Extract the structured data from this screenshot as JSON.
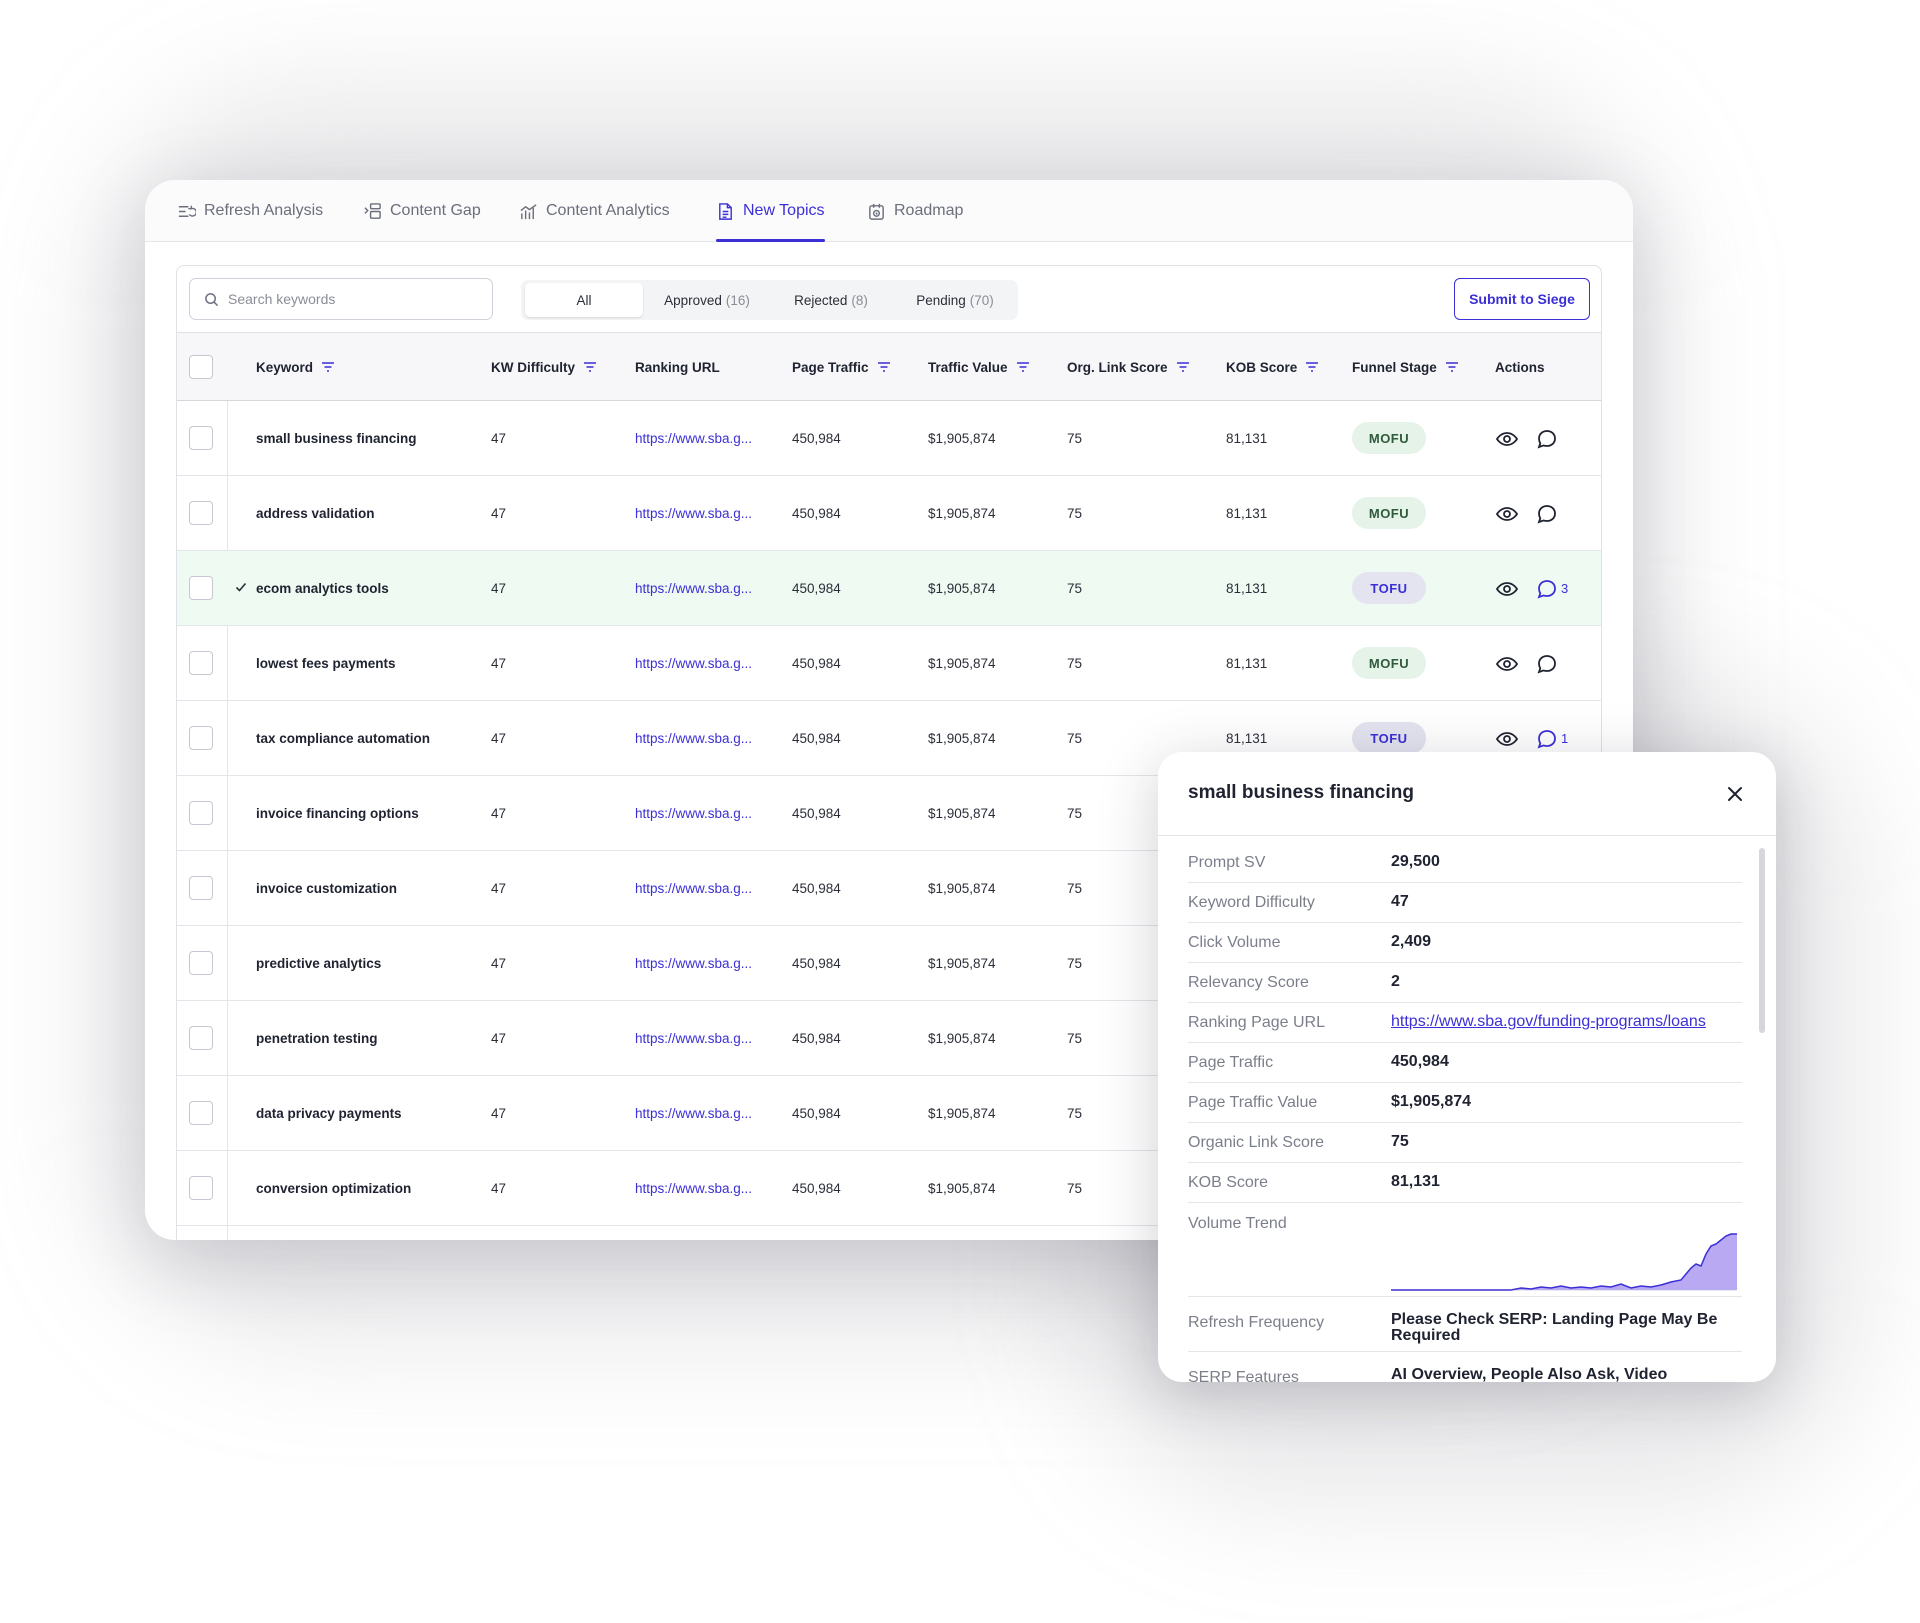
{
  "tabs": [
    {
      "label": "Refresh Analysis",
      "icon": "refresh-list-icon"
    },
    {
      "label": "Content Gap",
      "icon": "content-gap-icon"
    },
    {
      "label": "Content Analytics",
      "icon": "analytics-icon"
    },
    {
      "label": "New Topics",
      "icon": "document-icon",
      "active": true
    },
    {
      "label": "Roadmap",
      "icon": "roadmap-icon"
    }
  ],
  "search": {
    "placeholder": "Search keywords"
  },
  "filters": [
    {
      "label": "All",
      "count": ""
    },
    {
      "label": "Approved",
      "count": "(16)"
    },
    {
      "label": "Rejected",
      "count": "(8)"
    },
    {
      "label": "Pending",
      "count": "(70)"
    }
  ],
  "submit_label": "Submit to Siege",
  "columns": [
    "Keyword",
    "KW Difficulty",
    "Ranking URL",
    "Page Traffic",
    "Traffic Value",
    "Org. Link Score",
    "KOB Score",
    "Funnel Stage",
    "Actions"
  ],
  "rows": [
    {
      "keyword": "small business financing",
      "kd": "47",
      "url": "https://www.sba.g...",
      "traffic": "450,984",
      "value": "$1,905,874",
      "ols": "75",
      "kob": "81,131",
      "stage": "MOFU",
      "comments": ""
    },
    {
      "keyword": "address validation",
      "kd": "47",
      "url": "https://www.sba.g...",
      "traffic": "450,984",
      "value": "$1,905,874",
      "ols": "75",
      "kob": "81,131",
      "stage": "MOFU",
      "comments": ""
    },
    {
      "keyword": "ecom analytics tools",
      "kd": "47",
      "url": "https://www.sba.g...",
      "traffic": "450,984",
      "value": "$1,905,874",
      "ols": "75",
      "kob": "81,131",
      "stage": "TOFU",
      "comments": "3"
    },
    {
      "keyword": "lowest fees payments",
      "kd": "47",
      "url": "https://www.sba.g...",
      "traffic": "450,984",
      "value": "$1,905,874",
      "ols": "75",
      "kob": "81,131",
      "stage": "MOFU",
      "comments": ""
    },
    {
      "keyword": "tax compliance automation",
      "kd": "47",
      "url": "https://www.sba.g...",
      "traffic": "450,984",
      "value": "$1,905,874",
      "ols": "75",
      "kob": "81,131",
      "stage": "TOFU",
      "comments": "1"
    },
    {
      "keyword": "invoice financing options",
      "kd": "47",
      "url": "https://www.sba.g...",
      "traffic": "450,984",
      "value": "$1,905,874",
      "ols": "75",
      "kob": "",
      "stage": "",
      "comments": ""
    },
    {
      "keyword": "invoice customization",
      "kd": "47",
      "url": "https://www.sba.g...",
      "traffic": "450,984",
      "value": "$1,905,874",
      "ols": "75",
      "kob": "",
      "stage": "",
      "comments": ""
    },
    {
      "keyword": "predictive analytics",
      "kd": "47",
      "url": "https://www.sba.g...",
      "traffic": "450,984",
      "value": "$1,905,874",
      "ols": "75",
      "kob": "",
      "stage": "",
      "comments": ""
    },
    {
      "keyword": "penetration testing",
      "kd": "47",
      "url": "https://www.sba.g...",
      "traffic": "450,984",
      "value": "$1,905,874",
      "ols": "75",
      "kob": "",
      "stage": "",
      "comments": ""
    },
    {
      "keyword": "data privacy payments",
      "kd": "47",
      "url": "https://www.sba.g...",
      "traffic": "450,984",
      "value": "$1,905,874",
      "ols": "75",
      "kob": "",
      "stage": "",
      "comments": ""
    },
    {
      "keyword": "conversion optimization",
      "kd": "47",
      "url": "https://www.sba.g...",
      "traffic": "450,984",
      "value": "$1,905,874",
      "ols": "75",
      "kob": "",
      "stage": "",
      "comments": ""
    }
  ],
  "colors": {
    "accent": "#3b2fd6",
    "mofu_bg": "#e5f3e9",
    "tofu_bg": "#e3e4ef",
    "highlight_row": "#effaf2"
  },
  "detail": {
    "title": "small business financing",
    "fields": [
      {
        "label": "Prompt SV",
        "value": "29,500"
      },
      {
        "label": "Keyword Difficulty",
        "value": "47"
      },
      {
        "label": "Click Volume",
        "value": "2,409"
      },
      {
        "label": "Relevancy Score",
        "value": "2"
      },
      {
        "label": "Ranking Page URL",
        "value": "https://www.sba.gov/funding-programs/loans",
        "link": true
      },
      {
        "label": "Page Traffic",
        "value": "450,984"
      },
      {
        "label": "Page Traffic Value",
        "value": "$1,905,874"
      },
      {
        "label": "Organic Link Score",
        "value": "75"
      },
      {
        "label": "KOB Score",
        "value": "81,131"
      }
    ],
    "trend_label": "Volume Trend",
    "refresh_label": "Refresh Frequency",
    "refresh_value": "Please Check SERP: Landing Page May Be Required",
    "serp_label": "SERP Features",
    "serp_value": "AI Overview, People Also Ask, Video Thumbnails, Sitelink, Paid Search Bottom"
  }
}
